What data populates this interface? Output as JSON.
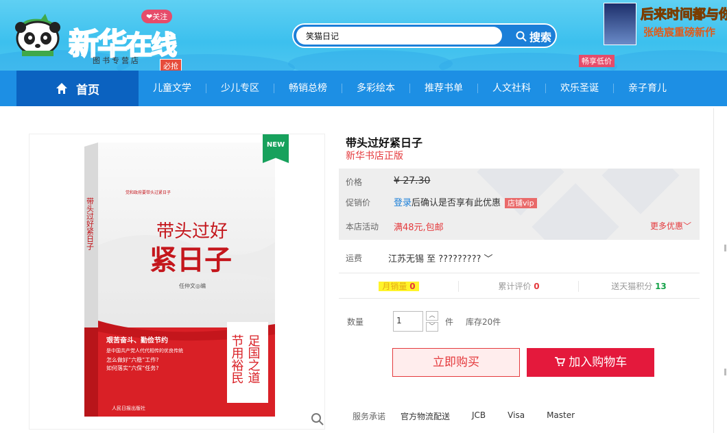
{
  "header": {
    "logo_text_1": "新华",
    "logo_text_2": "在线",
    "follow_badge": "❤关注",
    "store_tag": "图书专营店",
    "must_grab": "必抢",
    "search": {
      "value": "笑猫日记",
      "button_label": "搜索"
    },
    "promo": {
      "line1": "后来时间都与你",
      "line2": "张皓宸重磅新作",
      "badge": "畅享低价"
    }
  },
  "nav": {
    "home_label": "首页",
    "items": [
      "儿童文学",
      "少儿专区",
      "畅销总榜",
      "多彩绘本",
      "推荐书单",
      "人文社科",
      "欢乐圣诞",
      "亲子育儿"
    ]
  },
  "gallery": {
    "new_badge": "NEW",
    "cover": {
      "vertical_title": "带头过好紧日子",
      "title_line1": "带头过好",
      "title_line2": "紧日子",
      "author": "任仲文◎编",
      "red_lines": [
        "艰苦奋斗、勤俭节约",
        "是中国共产党人代代相传的优良传统",
        "怎么做好“六稳”工作?",
        "如何落实“六保”任务?"
      ],
      "slogan_col1": "节用裕民",
      "slogan_col2": "足国之道",
      "publisher": "人民日报出版社"
    }
  },
  "product": {
    "title": "带头过好紧日子",
    "subtitle": "新华书店正版",
    "price_label": "价格",
    "price_value": "¥ 27.30",
    "promo_label": "促销价",
    "promo_link": "登录",
    "promo_text": "后确认是否享有此优惠",
    "vip_badge": "店铺vip",
    "activity_label": "本店活动",
    "activity_value": "满48元,包邮",
    "more_label": "更多优惠",
    "shipping_label": "运费",
    "shipping_value": "江苏无锡 至 ?????????",
    "stats": [
      {
        "label": "月销量",
        "value": "0"
      },
      {
        "label": "累计评价",
        "value": "0"
      },
      {
        "label": "送天猫积分",
        "value": "13"
      }
    ],
    "quantity_label": "数量",
    "quantity_value": "1",
    "unit": "件",
    "stock": "库存20件",
    "buy_now": "立即购买",
    "add_cart": "加入购物车",
    "service_label": "服务承诺",
    "services": [
      "官方物流配送",
      "JCB",
      "Visa",
      "Master"
    ]
  },
  "colors": {
    "accent_red": "#e4393c",
    "nav_blue": "#1d8fe4",
    "nav_dark_blue": "#0b62c0",
    "highlight_yellow": "#fff42a"
  }
}
